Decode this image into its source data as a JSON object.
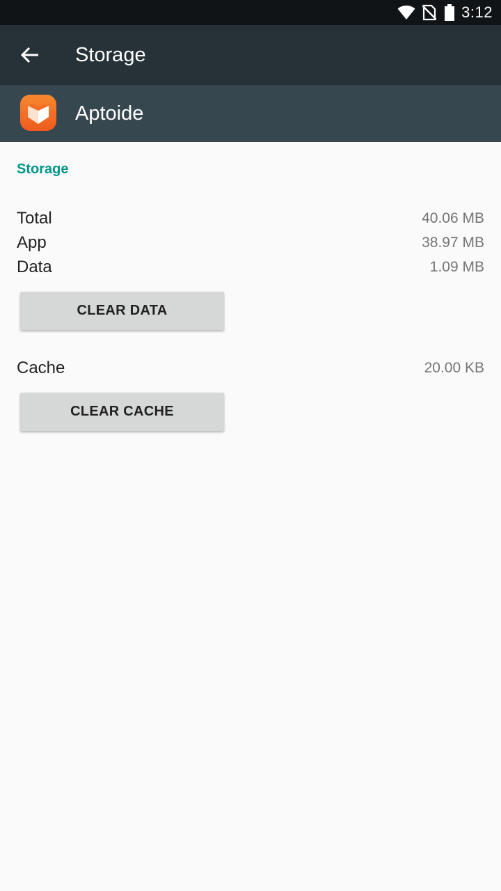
{
  "status_bar": {
    "time": "3:12",
    "icons": [
      "wifi-icon",
      "no-sim-icon",
      "battery-icon"
    ]
  },
  "app_bar": {
    "title": "Storage",
    "back_icon": "arrow-back-icon"
  },
  "app_header": {
    "name": "Aptoide",
    "icon": "aptoide-logo-icon"
  },
  "storage": {
    "section_title": "Storage",
    "rows": [
      {
        "label": "Total",
        "value": "40.06 MB"
      },
      {
        "label": "App",
        "value": "38.97 MB"
      },
      {
        "label": "Data",
        "value": "1.09 MB"
      }
    ],
    "clear_data_label": "CLEAR DATA",
    "cache": {
      "label": "Cache",
      "value": "20.00 KB"
    },
    "clear_cache_label": "CLEAR CACHE"
  },
  "colors": {
    "status_bar": "#101417",
    "app_bar": "#263238",
    "app_header": "#37474f",
    "accent": "#009688",
    "background": "#fafafa",
    "button": "#d6d7d7",
    "app_icon": "#f36f24"
  }
}
